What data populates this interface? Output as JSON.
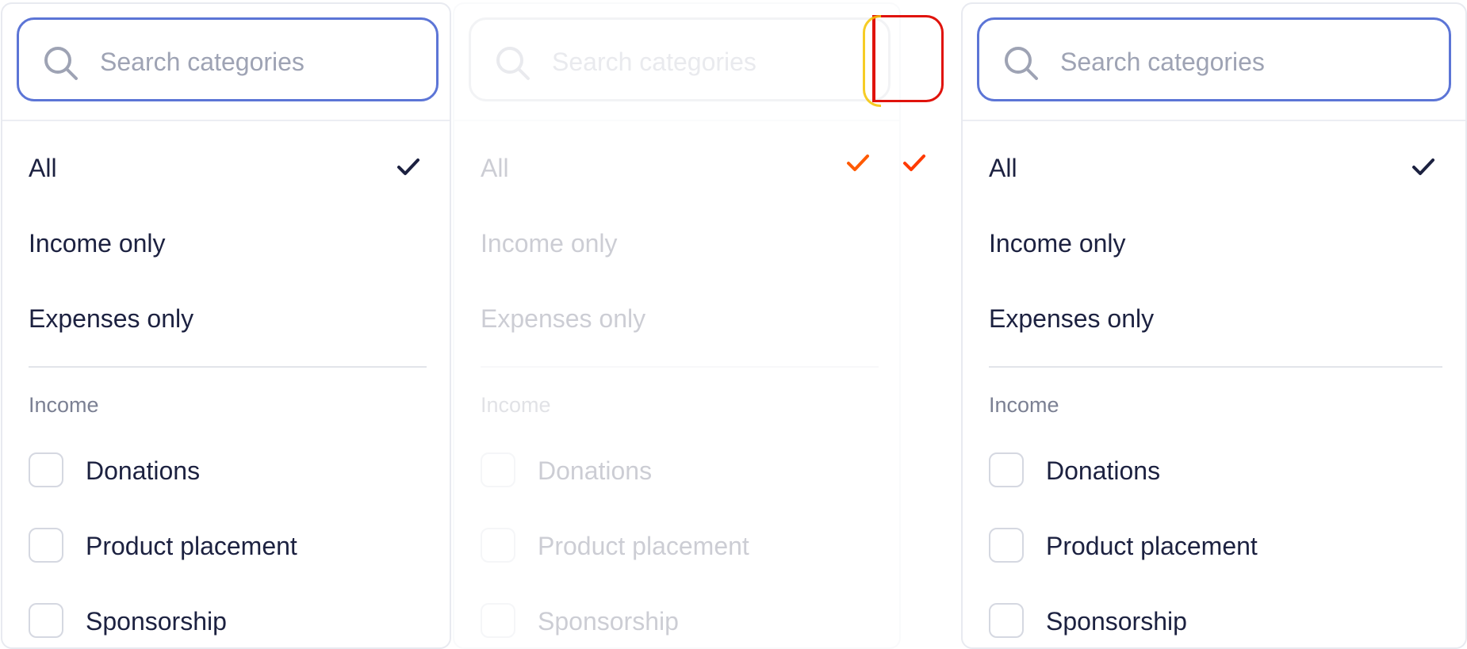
{
  "search": {
    "placeholder": "Search categories"
  },
  "options": [
    "All",
    "Income only",
    "Expenses only"
  ],
  "selected_option": "All",
  "section": {
    "label": "Income",
    "items": [
      "Donations",
      "Product placement",
      "Sponsorship"
    ]
  },
  "colors": {
    "accent": "#5c75d6",
    "text": "#1c2140",
    "muted": "#9ea3b4",
    "highlight_red": "#e0130c",
    "highlight_orange": "#ff5a00"
  },
  "icons": {
    "search": "search-icon",
    "check": "check-icon"
  }
}
